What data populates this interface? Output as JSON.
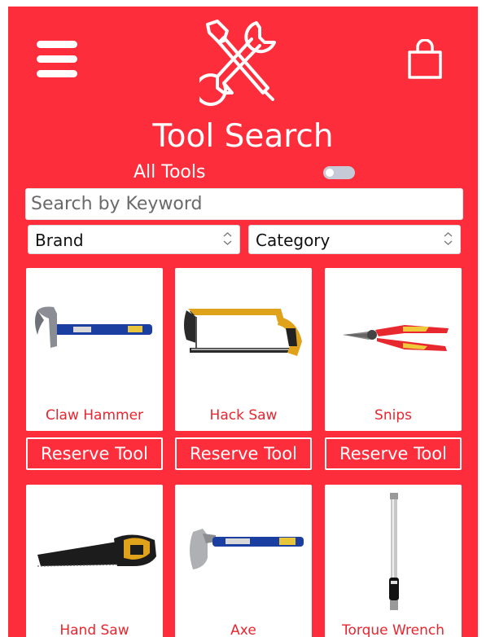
{
  "header": {
    "menu_icon": "hamburger-menu-icon",
    "logo_icon": "crossed-wrench-screwdriver-logo",
    "bag_icon": "shopping-bag-icon",
    "title": "Tool Search"
  },
  "filters": {
    "all_tools_label": "All Tools",
    "all_tools_on": false,
    "search_placeholder": "Search by Keyword",
    "search_value": "",
    "brand_selected": "Brand",
    "category_selected": "Category"
  },
  "tools": [
    {
      "name": "Claw Hammer",
      "reserve_label": "Reserve Tool",
      "image_icon": "claw-hammer-image"
    },
    {
      "name": "Hack Saw",
      "reserve_label": "Reserve Tool",
      "image_icon": "hack-saw-image"
    },
    {
      "name": "Snips",
      "reserve_label": "Reserve Tool",
      "image_icon": "snips-image"
    },
    {
      "name": "Hand Saw",
      "image_icon": "hand-saw-image"
    },
    {
      "name": "Axe",
      "image_icon": "axe-image"
    },
    {
      "name": "Torque Wrench",
      "image_icon": "torque-wrench-image"
    }
  ],
  "colors": {
    "background": "#fd2d3c",
    "tool_name": "#e8262f",
    "white": "#ffffff"
  }
}
